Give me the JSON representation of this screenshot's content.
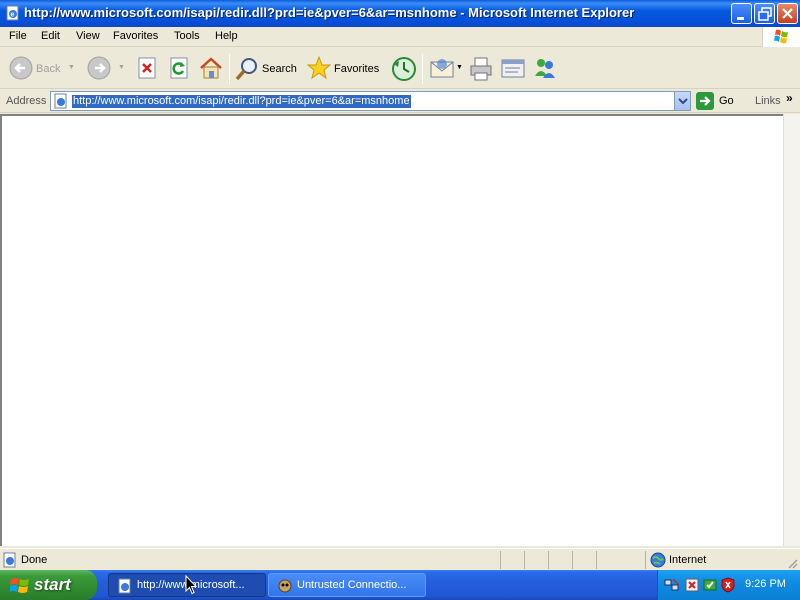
{
  "window": {
    "title": "http://www.microsoft.com/isapi/redir.dll?prd=ie&pver=6&ar=msnhome - Microsoft Internet Explorer"
  },
  "menu": {
    "items": [
      {
        "label": "File"
      },
      {
        "label": "Edit"
      },
      {
        "label": "View"
      },
      {
        "label": "Favorites"
      },
      {
        "label": "Tools"
      },
      {
        "label": "Help"
      }
    ]
  },
  "toolbar": {
    "back_label": "Back",
    "search_label": "Search",
    "favorites_label": "Favorites"
  },
  "address": {
    "label": "Address",
    "url": "http://www.microsoft.com/isapi/redir.dll?prd=ie&pver=6&ar=msnhome",
    "go_label": "Go",
    "links_label": "Links",
    "links_chevron": "»"
  },
  "status": {
    "text": "Done",
    "zone": "Internet"
  },
  "taskbar": {
    "start_label": "start",
    "tasks": [
      {
        "label": "http://www.microsoft...",
        "active": true
      },
      {
        "label": "Untrusted Connectio...",
        "active": false
      }
    ],
    "clock": "9:26 PM"
  },
  "colors": {
    "titlebar": "#0558e0",
    "taskbar": "#245edb",
    "start_button": "#3c9a3c",
    "tray": "#0f8ce2",
    "selection": "#316ac5"
  }
}
